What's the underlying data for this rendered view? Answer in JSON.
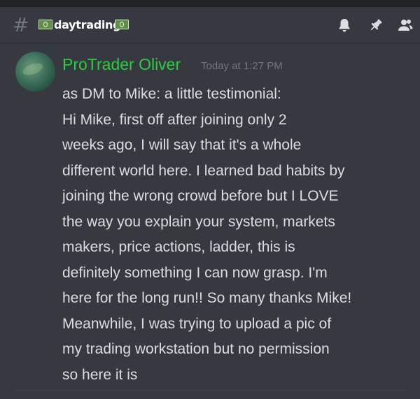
{
  "channel": {
    "name": "daytrading",
    "hash_symbol": "#",
    "emoji_left": "money-bill-icon",
    "emoji_right": "money-bill-icon"
  },
  "header_icons": [
    "bell-icon",
    "pin-icon",
    "members-icon"
  ],
  "message": {
    "author": "ProTrader Oliver",
    "author_color": "#2ecc40",
    "timestamp": "Today at 1:27 PM",
    "lines": [
      "as DM to Mike: a little testimonial:",
      "Hi Mike, first off after joining only 2",
      "weeks ago, I will say that it's a whole",
      "different world here. I learned bad habits by",
      "joining the wrong crowd before but I LOVE",
      "the way you explain your system, markets",
      "makers, price actions, ladder, this is",
      "definitely something I can now grasp. I'm",
      "here for the long run!! So many thanks Mike!",
      "Meanwhile, I was trying to upload a pic of",
      "my trading workstation but no permission",
      "so here it is"
    ]
  },
  "colors": {
    "background": "#36393f",
    "text": "#dcddde",
    "muted": "#72767d",
    "icon": "#dcddde"
  }
}
